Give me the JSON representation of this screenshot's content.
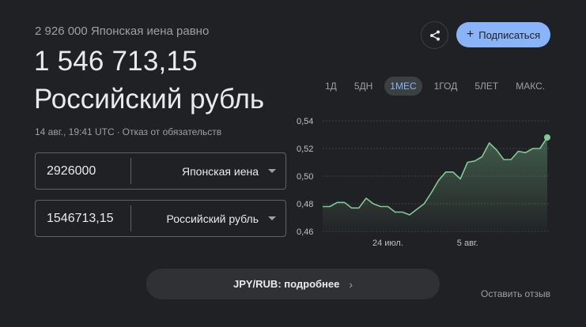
{
  "header": {
    "subtitle": "2 926 000 Японская иена равно",
    "result_value": "1 546 713,15",
    "result_currency": "Российский рубль",
    "timestamp": "14 авг., 19:41 UTC",
    "disclaimer": "Отказ от обязательств"
  },
  "converter": {
    "from": {
      "value": "2926000",
      "currency": "Японская иена"
    },
    "to": {
      "value": "1546713,15",
      "currency": "Российский рубль"
    }
  },
  "actions": {
    "share_icon": "share-icon",
    "subscribe_label": "Подписаться"
  },
  "ranges": [
    "1Д",
    "5ДН",
    "1МЕС",
    "1ГОД",
    "5ЛЕТ",
    "МАКС."
  ],
  "active_range": "1МЕС",
  "chart_data": {
    "type": "area",
    "ylim": [
      0.46,
      0.54
    ],
    "y_ticks": [
      "0,54",
      "0,52",
      "0,50",
      "0,48",
      "0,46"
    ],
    "x_tick_labels": [
      "24 июл.",
      "5 авг."
    ],
    "line_color": "#81c995",
    "grid": "dashed horizontal",
    "values": [
      0.478,
      0.478,
      0.481,
      0.481,
      0.477,
      0.477,
      0.484,
      0.48,
      0.478,
      0.478,
      0.474,
      0.474,
      0.472,
      0.476,
      0.48,
      0.488,
      0.497,
      0.503,
      0.503,
      0.498,
      0.51,
      0.511,
      0.514,
      0.524,
      0.519,
      0.512,
      0.512,
      0.518,
      0.517,
      0.52,
      0.52,
      0.528
    ]
  },
  "footer": {
    "more_label": "JPY/RUB: подробнее",
    "feedback_label": "Оставить отзыв"
  }
}
